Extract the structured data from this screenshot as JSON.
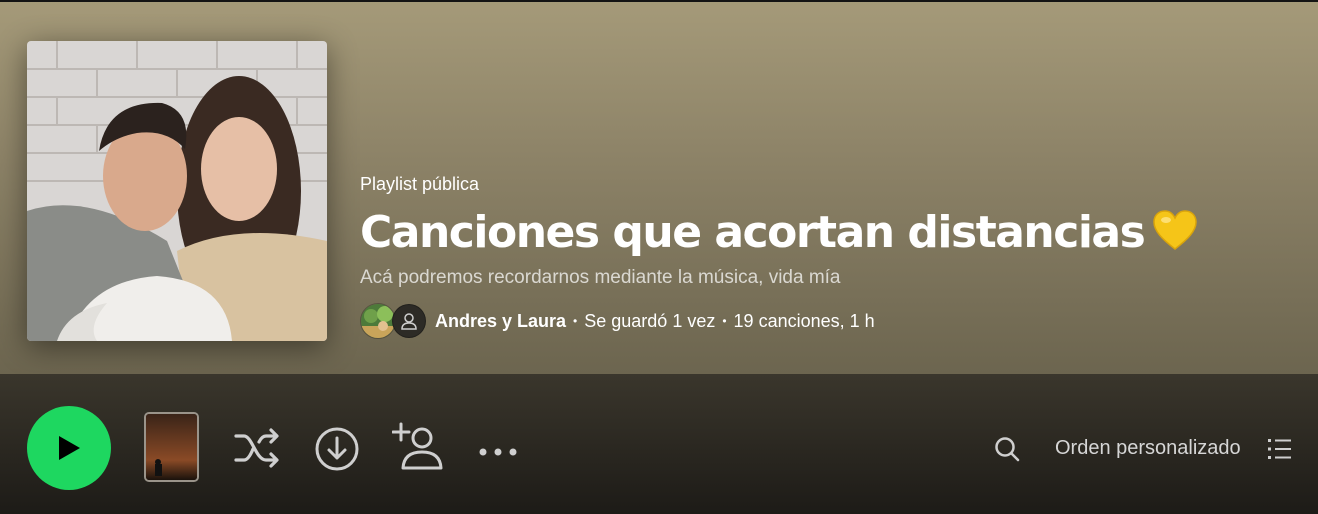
{
  "playlist": {
    "type_label": "Playlist pública",
    "title": "Canciones que acortan distancias",
    "description": "Acá podremos recordarnos mediante la música, vida mía",
    "owner": "Andres y Laura",
    "saved": "Se guardó 1 vez",
    "stats": "19 canciones, 1 h",
    "separator": "•"
  },
  "toolbar": {
    "sort_label": "Orden personalizado"
  },
  "icons": {
    "play": "play-icon",
    "shuffle": "shuffle-icon",
    "download": "download-icon",
    "invite": "add-collaborator-icon",
    "more": "more-options-icon",
    "search": "search-icon",
    "list": "list-view-icon",
    "heart": "yellow-heart-emoji"
  },
  "colors": {
    "accent": "#1ed760",
    "header_top": "#a59a79",
    "header_bottom": "#6c654f",
    "heart": "#f5c518"
  }
}
